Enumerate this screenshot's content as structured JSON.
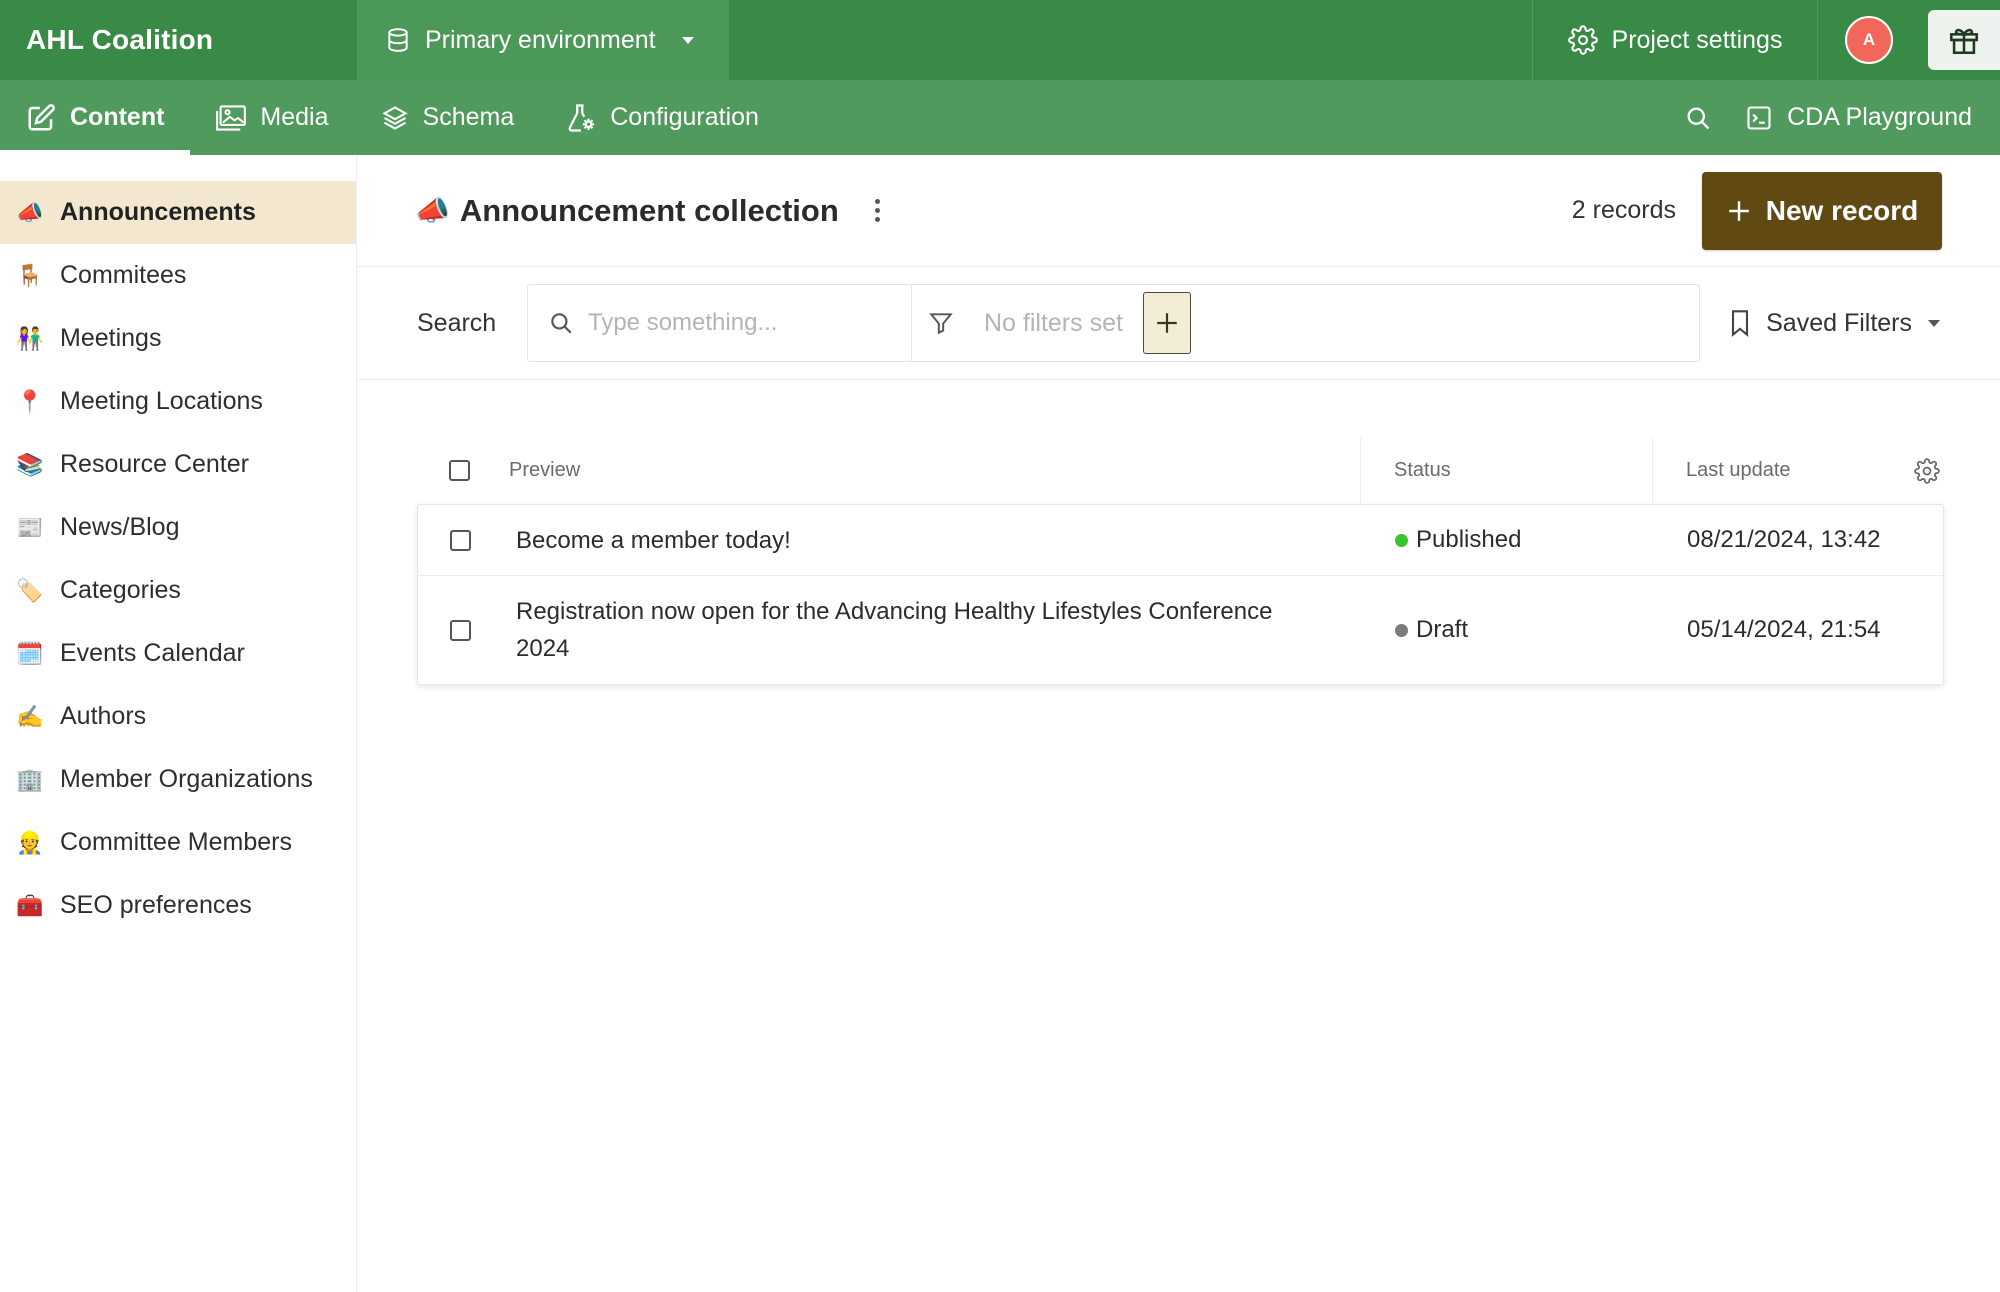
{
  "topbar": {
    "brand": "AHL Coalition",
    "environment": "Primary environment",
    "project_settings": "Project settings",
    "avatar_initial": "A"
  },
  "subnav": {
    "tabs": [
      {
        "label": "Content",
        "icon": "edit-icon",
        "active": true
      },
      {
        "label": "Media",
        "icon": "image-icon",
        "active": false
      },
      {
        "label": "Schema",
        "icon": "layers-icon",
        "active": false
      },
      {
        "label": "Configuration",
        "icon": "flask-gear-icon",
        "active": false
      }
    ],
    "cda_playground": "CDA Playground"
  },
  "sidebar": {
    "items": [
      {
        "emoji": "📣",
        "label": "Announcements",
        "active": true
      },
      {
        "emoji": "🪑",
        "label": "Commitees"
      },
      {
        "emoji": "👫",
        "label": "Meetings"
      },
      {
        "emoji": "📍",
        "label": "Meeting Locations"
      },
      {
        "emoji": "📚",
        "label": "Resource Center"
      },
      {
        "emoji": "📰",
        "label": "News/Blog"
      },
      {
        "emoji": "🏷️",
        "label": "Categories"
      },
      {
        "emoji": "🗓️",
        "label": "Events Calendar"
      },
      {
        "emoji": "✍️",
        "label": "Authors"
      },
      {
        "emoji": "🏢",
        "label": "Member Organizations"
      },
      {
        "emoji": "👷",
        "label": "Committee Members"
      },
      {
        "emoji": "🧰",
        "label": "SEO preferences"
      }
    ]
  },
  "main": {
    "title_emoji": "📣",
    "title": "Announcement collection",
    "record_count": "2 records",
    "new_record": "New record",
    "search_label": "Search",
    "search_placeholder": "Type something...",
    "no_filters": "No filters set",
    "saved_filters": "Saved Filters"
  },
  "table": {
    "columns": {
      "preview": "Preview",
      "status": "Status",
      "last_update": "Last update"
    },
    "rows": [
      {
        "preview": "Become a member today!",
        "status": "Published",
        "status_color": "#3cc22e",
        "last_update": "08/21/2024, 13:42"
      },
      {
        "preview": "Registration now open for the Advancing Healthy Lifestyles Conference 2024",
        "status": "Draft",
        "status_color": "#7c7c7c",
        "last_update": "05/14/2024, 21:54"
      }
    ]
  },
  "colors": {
    "topbar": "#388a46",
    "subnav": "#4f9a5c",
    "accent_button": "#614914",
    "active_sidebar": "#f3e8cf"
  }
}
